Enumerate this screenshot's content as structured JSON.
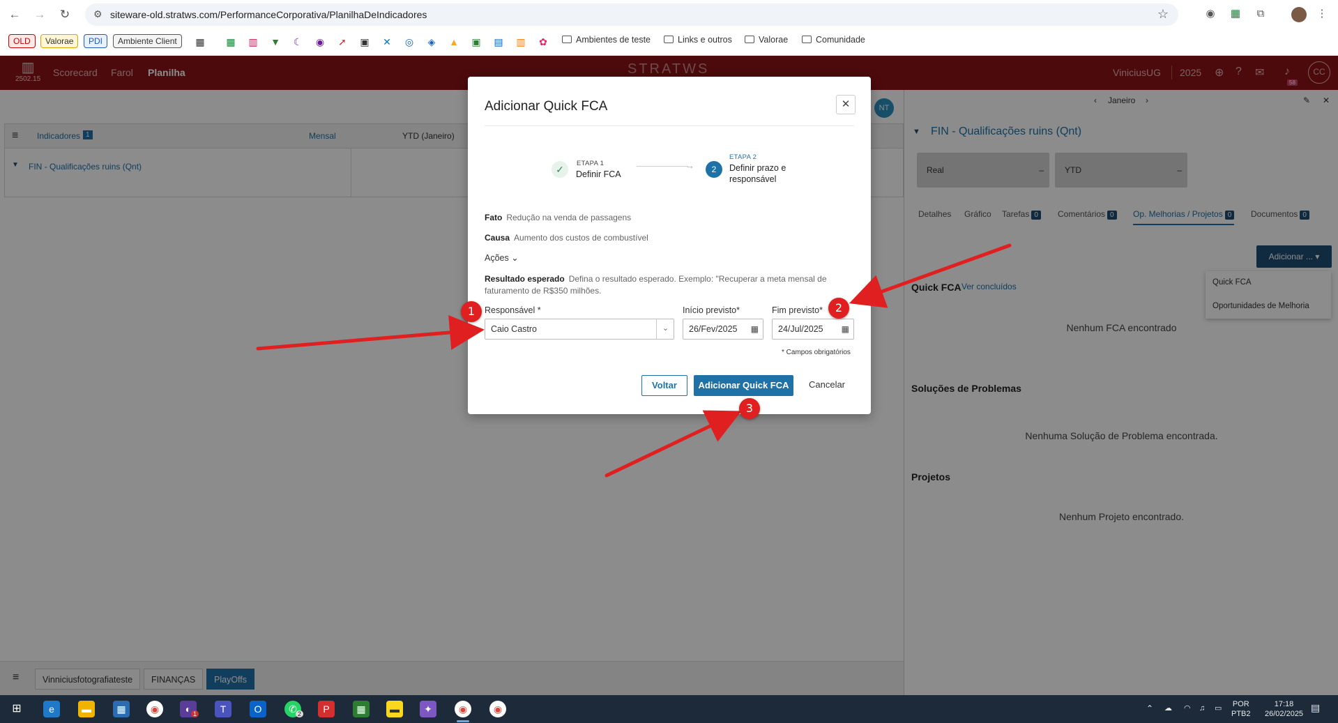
{
  "browser": {
    "url": "siteware-old.stratws.com/PerformanceCorporativa/PlanilhaDeIndicadores",
    "bookmarks_tags": [
      "OLD",
      "Valorae",
      "PDI",
      "Ambiente Client"
    ],
    "bookmark_folders": [
      "Ambientes de teste",
      "Links e outros",
      "Valorae",
      "Comunidade"
    ]
  },
  "app": {
    "logo_version": "2502.15",
    "nav": [
      "Scorecard",
      "Farol",
      "Planilha"
    ],
    "brand": "STRATWS",
    "user": "ViniciusUG",
    "year": "2025",
    "avatar_initials": "CC",
    "notif_count": "58",
    "nt_initials": "NT"
  },
  "grid": {
    "indicadores_label": "Indicadores",
    "indicadores_count": "1",
    "period": "Mensal",
    "ytd_col": "YTD (Janeiro)",
    "row_label": "FIN - Qualificações ruins (Qnt)"
  },
  "bottom_tabs": [
    "Vinniciusfotografiateste",
    "FINANÇAS",
    "PlayOffs"
  ],
  "right_panel": {
    "month": "Janeiro",
    "title": "FIN - Qualificações ruins (Qnt)",
    "cards": [
      "Real",
      "YTD"
    ],
    "card_value": "–",
    "tabs": [
      {
        "label": "Detalhes",
        "count": ""
      },
      {
        "label": "Gráfico",
        "count": ""
      },
      {
        "label": "Tarefas",
        "count": "0"
      },
      {
        "label": "Comentários",
        "count": "0"
      },
      {
        "label": "Op. Melhorias / Projetos",
        "count": "0"
      },
      {
        "label": "Documentos",
        "count": "0"
      }
    ],
    "add_button": "Adicionar ...",
    "dropdown": [
      "Quick FCA",
      "Oportunidades de Melhoria"
    ],
    "quick_fca_title": "Quick FCA",
    "ver_concluidos": "Ver concluídos",
    "no_fca": "Nenhum FCA encontrado",
    "solucoes_title": "Soluções de Problemas",
    "no_solucao": "Nenhuma Solução de Problema encontrada.",
    "projetos_title": "Projetos",
    "no_projeto": "Nenhum Projeto encontrado."
  },
  "modal": {
    "title": "Adicionar Quick FCA",
    "step1_small": "ETAPA 1",
    "step1_label": "Definir FCA",
    "step2_small": "ETAPA 2",
    "step2_label_a": "Definir prazo e",
    "step2_label_b": "responsável",
    "step2_num": "2",
    "fato_label": "Fato",
    "fato_value": "Redução na venda de passagens",
    "causa_label": "Causa",
    "causa_value": "Aumento dos custos de combustível",
    "acoes_label": "Ações",
    "resultado_label": "Resultado esperado",
    "resultado_value_a": "Defina o resultado esperado. Exemplo: \"Recuperar a meta mensal de",
    "resultado_value_b": "faturamento de R$350 milhões.",
    "responsavel_label": "Responsável *",
    "responsavel_value": "Caio Castro",
    "inicio_label": "Início previsto*",
    "inicio_value": "26/Fev/2025",
    "fim_label": "Fim previsto*",
    "fim_value": "24/Jul/2025",
    "required_note": "* Campos obrigatórios",
    "btn_voltar": "Voltar",
    "btn_add": "Adicionar Quick FCA",
    "btn_cancel": "Cancelar"
  },
  "annotations": [
    "1",
    "2",
    "3"
  ],
  "annotation_color": "#e02020",
  "taskbar": {
    "lang_a": "POR",
    "lang_b": "PTB2",
    "time": "17:18",
    "date": "26/02/2025",
    "teams_badge": "1",
    "whatsapp_badge": "2"
  },
  "colors": {
    "app_bar": "#8a1316",
    "primary": "#1e72a8",
    "taskbar": "#1c2a3a"
  }
}
